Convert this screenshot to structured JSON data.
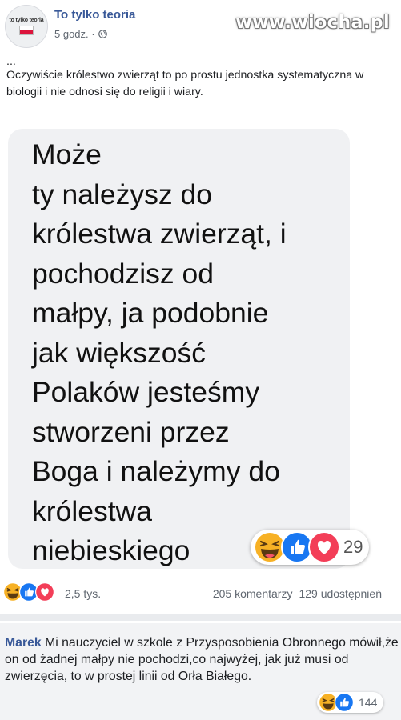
{
  "post": {
    "page_name": "To tylko teoria",
    "time": "5 godz. ·",
    "avatar_logo": "to tylko teoria",
    "ellipsis": "...",
    "text": "Oczywiście królestwo zwierząt to po prostu jednostka systematyczna w biologii i nie odnosi się do religii i wiary."
  },
  "watermark": "www.wiocha.pl",
  "image": {
    "message": "Może\nty należysz do\nkrólestwa  zwierząt, i\npochodzisz od\nmałpy, ja podobnie\njak większość\nPolaków jesteśmy\nstworzeni przez\nBoga i należymy do\nkrólestwa\nniebieskiego",
    "reaction_count": "29",
    "reactions": [
      "haha-icon",
      "like-icon",
      "love-icon"
    ]
  },
  "stats": {
    "reactions_count": "2,5 tys.",
    "comments": "205 komentarzy",
    "shares": "129 udostępnień"
  },
  "comment": {
    "author": "Marek",
    "text": "Mi nauczyciel w szkole z Przysposobienia Obronnego mówił,że on od żadnej małpy nie pochodzi,co najwyżej, jak już musi od zwierzęcia, to w prostej linii od    Orła Białego.",
    "reaction_count": "144",
    "reactions": [
      "haha-icon",
      "like-icon"
    ]
  },
  "colors": {
    "link_blue": "#385898",
    "like_blue": "#1877f2",
    "love_red": "#f33e58",
    "haha_yellow": "#f7b125"
  }
}
